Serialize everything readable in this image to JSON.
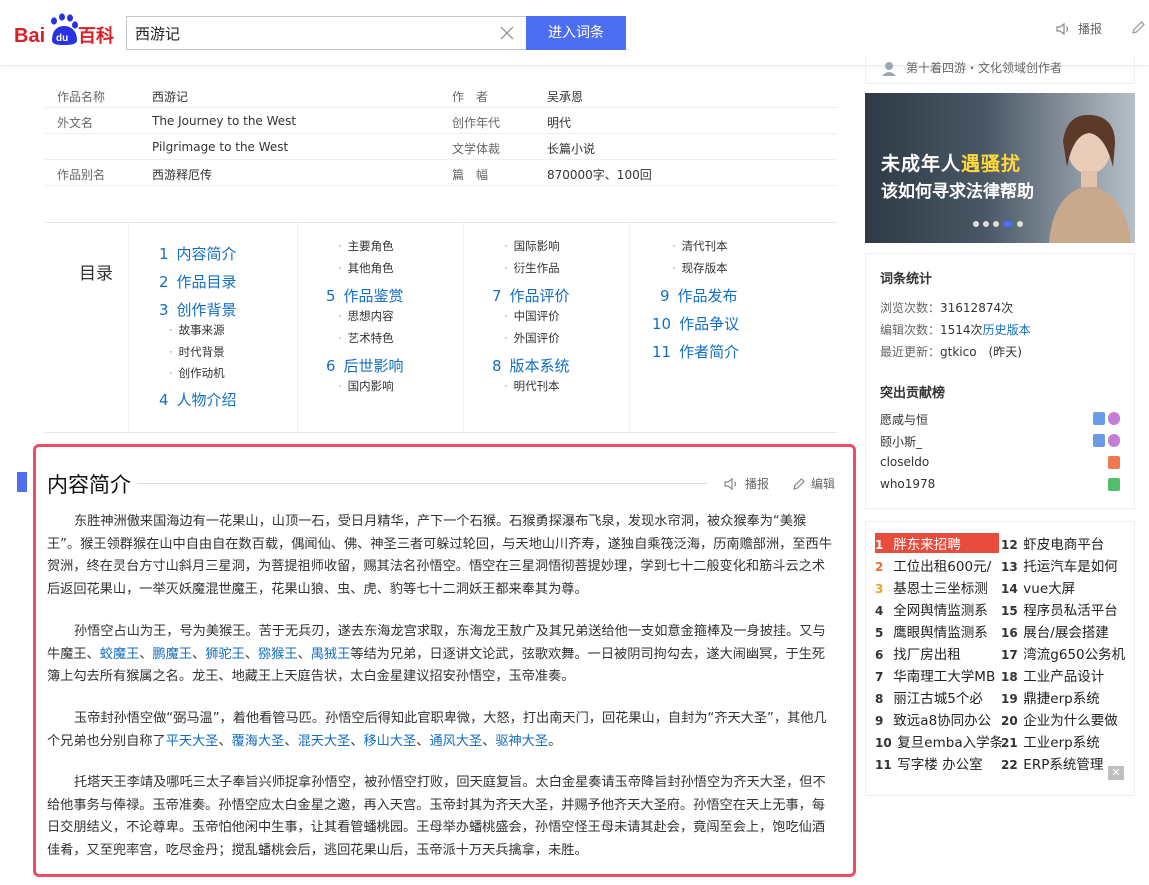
{
  "header": {
    "logo_bai": "Bai",
    "logo_du": "du",
    "logo_baike": "百科",
    "search_value": "西游记",
    "search_button": "进入词条",
    "tool_read": "播报",
    "colors": {
      "brand_blue": "#4e6ef2",
      "brand_red": "#de1e27"
    }
  },
  "basic_info": {
    "rows": [
      {
        "k1": "作品名称",
        "v1": "西游记",
        "k2": "作　者",
        "v2": "吴承恩"
      },
      {
        "k1": "外文名",
        "v1": "The Journey to the West",
        "k2": "创作年代",
        "v2": "明代"
      },
      {
        "k1": "",
        "v1": "Pilgrimage to the West",
        "k2": "文学体裁",
        "v2": "长篇小说"
      },
      {
        "k1": "作品别名",
        "v1": "西游释厄传",
        "k2": "篇　幅",
        "v2": "870000字、100回"
      }
    ]
  },
  "catalog": {
    "title": "目录",
    "col1": [
      {
        "num": "1",
        "label": "内容简介"
      },
      {
        "num": "2",
        "label": "作品目录"
      },
      {
        "num": "3",
        "label": "创作背景"
      },
      {
        "sub": "故事来源"
      },
      {
        "sub": "时代背景"
      },
      {
        "sub": "创作动机"
      },
      {
        "num": "4",
        "label": "人物介绍"
      }
    ],
    "col2": [
      {
        "sub": "主要角色"
      },
      {
        "sub": "其他角色"
      },
      {
        "num": "5",
        "label": "作品鉴赏"
      },
      {
        "sub": "思想内容"
      },
      {
        "sub": "艺术特色"
      },
      {
        "num": "6",
        "label": "后世影响"
      },
      {
        "sub": "国内影响"
      }
    ],
    "col3": [
      {
        "sub": "国际影响"
      },
      {
        "sub": "衍生作品"
      },
      {
        "num": "7",
        "label": "作品评价"
      },
      {
        "sub": "中国评价"
      },
      {
        "sub": "外国评价"
      },
      {
        "num": "8",
        "label": "版本系统"
      },
      {
        "sub": "明代刊本"
      }
    ],
    "col4": [
      {
        "sub": "清代刊本"
      },
      {
        "sub": "现存版本"
      },
      {
        "num": "9",
        "label": "作品发布"
      },
      {
        "num": "10",
        "label": "作品争议"
      },
      {
        "num": "11",
        "label": "作者简介"
      }
    ]
  },
  "intro": {
    "title": "内容简介",
    "tool_read": "播报",
    "tool_edit": "编辑",
    "p1": "东胜神洲傲来国海边有一花果山，山顶一石，受日月精华，产下一个石猴。石猴勇探瀑布飞泉，发现水帘洞，被众猴奉为“美猴王”。猴王领群猴在山中自由自在数百载，偶闻仙、佛、神圣三者可躲过轮回，与天地山川齐寿，遂独自乘筏泛海，历南赡部洲，至西牛贺洲，终在灵台方寸山斜月三星洞，为菩提祖师收留，赐其法名孙悟空。悟空在三星洞悟彻菩提妙理，学到七十二般变化和筋斗云之术后返回花果山，一举灭妖魔混世魔王，花果山狼、虫、虎、豹等七十二洞妖王都来奉其为尊。",
    "p2a": "孙悟空占山为王，号为美猴王。苦于无兵刃，遂去东海龙宫求取，东海龙王敖广及其兄弟送给他一支如意金箍棒及一身披挂。又与牛魔王、",
    "p2_links": [
      "蛟魔王",
      "鹏魔王",
      "狮驼王",
      "猕猴王",
      "禺狨王"
    ],
    "p2b": "等结为兄弟，日逐讲文论武，弦歌欢舞。一日被阴司拘勾去，遂大闹幽冥，于生死簿上勾去所有猴属之名。龙王、地藏王上天庭告状，太白金星建议招安孙悟空，玉帝准奏。",
    "p3a": "玉帝封孙悟空做“弼马温”，着他看管马匹。孙悟空后得知此官职卑微，大怒，打出南天门，回花果山，自封为“齐天大圣”，其他几个兄弟也分别自称了",
    "p3_links": [
      "平天大圣",
      "覆海大圣",
      "混天大圣",
      "移山大圣",
      "通风大圣",
      "驱神大圣"
    ],
    "p3b": "。",
    "p4": "托塔天王李靖及哪吒三太子奉旨兴师捉拿孙悟空，被孙悟空打败，回天庭复旨。太白金星奏请玉帝降旨封孙悟空为齐天大圣，但不给他事务与俸禄。玉帝准奏。孙悟空应太白金星之邀，再入天宫。玉帝封其为齐天大圣，并赐予他齐天大圣府。孙悟空在天上无事，每日交朋结义，不论尊卑。玉帝怕他闲中生事，让其看管蟠桃园。王母举办蟠桃盛会，孙悟空怪王母未请其赴会，竟闯至会上，饱吃仙酒佳肴，又至兜率宫，吃尽金丹；搅乱蟠桃会后，逃回花果山后，玉帝派十万天兵擒拿，未胜。"
  },
  "right": {
    "partial_text": "第十着四游・文化领域创作者",
    "banner": {
      "headline_a": "未成年人",
      "headline_b": "遇骚扰",
      "sub": "该如何寻求法律帮助"
    },
    "stats": {
      "title": "词条统计",
      "views_label": "浏览次数：",
      "views": "31612874次",
      "edits_label": "编辑次数：",
      "edits": "1514次",
      "history_link": "历史版本",
      "updated_label": "最近更新：",
      "updated": "gtkico　(昨天)",
      "contrib_title": "突出贡献榜",
      "contributors": [
        "愿咸与恒",
        "颐小斯_",
        "closeldo",
        "who1978"
      ]
    },
    "hot": [
      {
        "rank": "1",
        "text": "胖东来招聘"
      },
      {
        "rank": "2",
        "text": "工位出租600元/"
      },
      {
        "rank": "3",
        "text": "基恩士三坐标测"
      },
      {
        "rank": "4",
        "text": "全网舆情监测系"
      },
      {
        "rank": "5",
        "text": "鹰眼舆情监测系"
      },
      {
        "rank": "6",
        "text": "找厂房出租"
      },
      {
        "rank": "7",
        "text": "华南理工大学MB"
      },
      {
        "rank": "8",
        "text": "丽江古城5个必"
      },
      {
        "rank": "9",
        "text": "致远a8协同办公"
      },
      {
        "rank": "10",
        "text": "复旦emba入学条"
      },
      {
        "rank": "11",
        "text": "写字楼 办公室"
      },
      {
        "rank": "12",
        "text": "虾皮电商平台"
      },
      {
        "rank": "13",
        "text": "托运汽车是如何"
      },
      {
        "rank": "14",
        "text": "vue大屏"
      },
      {
        "rank": "15",
        "text": "程序员私活平台"
      },
      {
        "rank": "16",
        "text": "展台/展会搭建"
      },
      {
        "rank": "17",
        "text": "湾流g650公务机"
      },
      {
        "rank": "18",
        "text": "工业产品设计"
      },
      {
        "rank": "19",
        "text": "鼎捷erp系统"
      },
      {
        "rank": "20",
        "text": "企业为什么要做"
      },
      {
        "rank": "21",
        "text": "工业erp系统"
      },
      {
        "rank": "22",
        "text": "ERP系统管理"
      }
    ]
  }
}
